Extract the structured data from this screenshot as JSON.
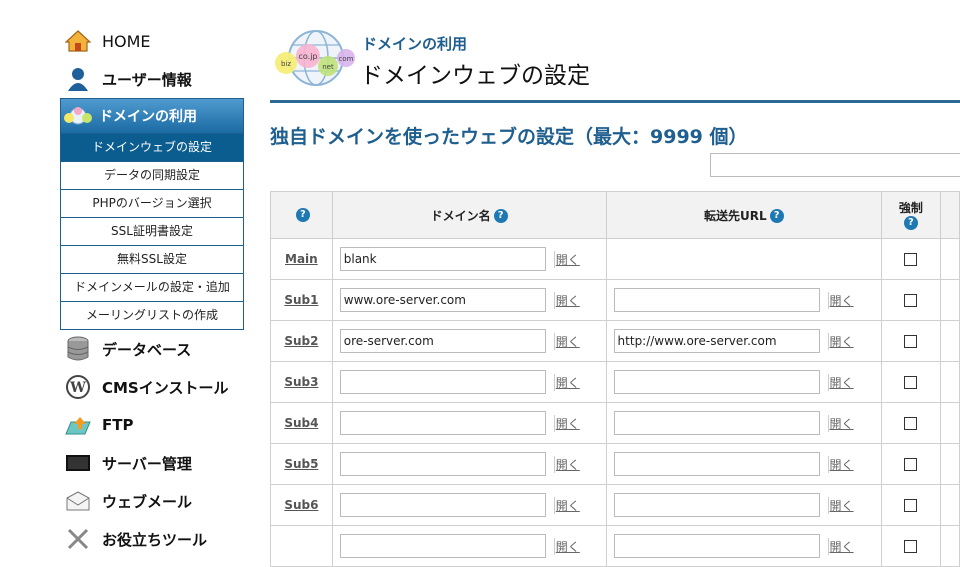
{
  "sidebar": {
    "home": "HOME",
    "user_info": "ユーザー情報",
    "domain_usage": "ドメインの利用",
    "submenu": [
      "ドメインウェブの設定",
      "データの同期設定",
      "PHPのバージョン選択",
      "SSL証明書設定",
      "無料SSL設定",
      "ドメインメールの設定・追加",
      "メーリングリストの作成"
    ],
    "lower": [
      "データベース",
      "CMSインストール",
      "FTP",
      "サーバー管理",
      "ウェブメール",
      "お役立ちツール"
    ]
  },
  "header": {
    "breadcrumb": "ドメインの利用",
    "title": "ドメインウェブの設定",
    "globe_labels": [
      "biz",
      "co.jp",
      "net",
      "com"
    ]
  },
  "section": {
    "title": "独自ドメインを使ったウェブの設定（最大：9999 個）",
    "search_value": ""
  },
  "table": {
    "headers": {
      "help": "?",
      "domain": "ドメイン名",
      "redirect": "転送先URL",
      "force": "強制"
    },
    "open_label": "開く",
    "rows": [
      {
        "name": "Main",
        "domain": "blank",
        "redirect": null
      },
      {
        "name": "Sub1",
        "domain": "www.ore-server.com",
        "redirect": ""
      },
      {
        "name": "Sub2",
        "domain": "ore-server.com",
        "redirect": "http://www.ore-server.com"
      },
      {
        "name": "Sub3",
        "domain": "",
        "redirect": ""
      },
      {
        "name": "Sub4",
        "domain": "",
        "redirect": ""
      },
      {
        "name": "Sub5",
        "domain": "",
        "redirect": ""
      },
      {
        "name": "Sub6",
        "domain": "",
        "redirect": ""
      },
      {
        "name": "",
        "domain": "",
        "redirect": ""
      }
    ]
  }
}
